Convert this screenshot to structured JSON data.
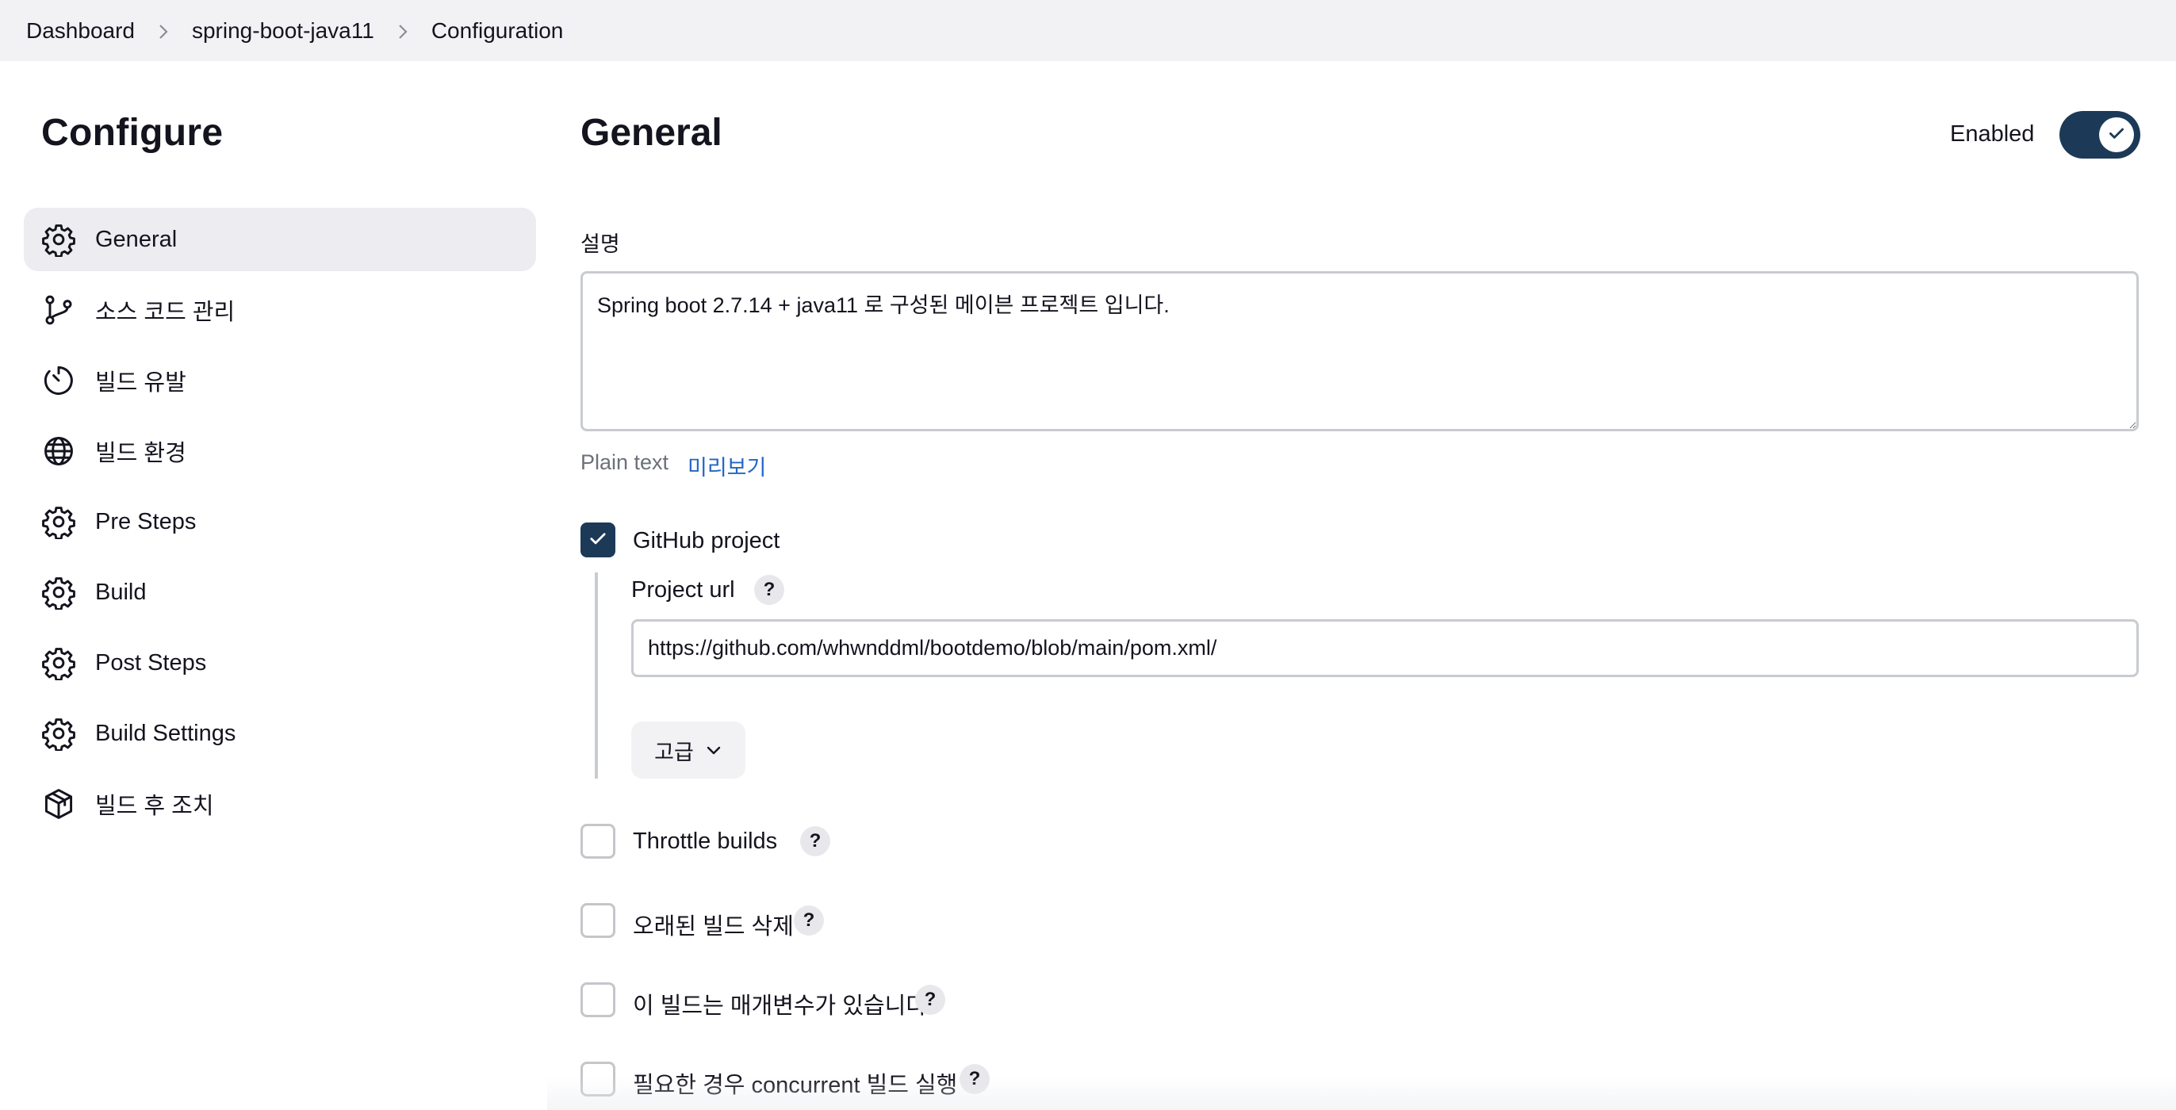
{
  "breadcrumb": {
    "items": [
      "Dashboard",
      "spring-boot-java11",
      "Configuration"
    ]
  },
  "sidebar": {
    "title": "Configure",
    "items": [
      {
        "label": "General",
        "icon": "gear-icon",
        "active": true
      },
      {
        "label": "소스 코드 관리",
        "icon": "branch-icon"
      },
      {
        "label": "빌드 유발",
        "icon": "timer-icon"
      },
      {
        "label": "빌드 환경",
        "icon": "globe-icon"
      },
      {
        "label": "Pre Steps",
        "icon": "gear-icon"
      },
      {
        "label": "Build",
        "icon": "gear-icon"
      },
      {
        "label": "Post Steps",
        "icon": "gear-icon"
      },
      {
        "label": "Build Settings",
        "icon": "gear-icon"
      },
      {
        "label": "빌드 후 조치",
        "icon": "package-icon"
      }
    ]
  },
  "main": {
    "title": "General",
    "enabled_label": "Enabled",
    "enabled": true,
    "description_label": "설명",
    "description_value": "Spring boot 2.7.14 + java11 로 구성된 메이븐 프로젝트 입니다.",
    "plain_text_label": "Plain text",
    "preview_label": "미리보기",
    "github_project": {
      "label": "GitHub project",
      "checked": true,
      "project_url_label": "Project url",
      "project_url_value": "https://github.com/whwnddml/bootdemo/blob/main/pom.xml/",
      "advanced_label": "고급"
    },
    "options": [
      {
        "label": "Throttle builds",
        "checked": false
      },
      {
        "label": "오래된 빌드 삭제",
        "checked": false
      },
      {
        "label": "이 빌드는 매개변수가 있습니다",
        "checked": false
      },
      {
        "label": "필요한 경우 concurrent 빌드 실행",
        "checked": false
      }
    ],
    "help_glyph": "?"
  },
  "colors": {
    "accent": "#1c3a58",
    "link": "#2366c6",
    "topbar_bg": "#f2f2f5",
    "active_nav_bg": "#ececf1"
  }
}
